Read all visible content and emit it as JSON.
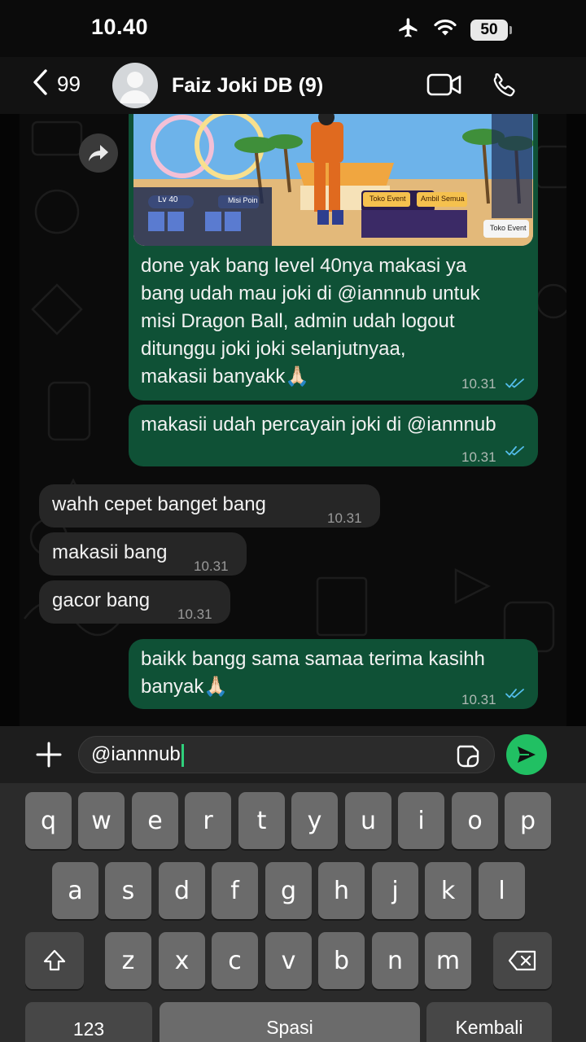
{
  "status_bar": {
    "time": "10.40",
    "battery": "50",
    "icons": [
      "airplane-icon",
      "wifi-icon",
      "battery-icon"
    ]
  },
  "header": {
    "back_count": "99",
    "title": "Faiz Joki DB (9)",
    "icons": [
      "back-chevron-icon",
      "avatar-icon",
      "video-call-icon",
      "phone-call-icon"
    ]
  },
  "messages": [
    {
      "direction": "out",
      "has_image": true,
      "text": "done yak bang level 40nya makasi ya\nbang udah mau joki di @iannnub untuk\nmisi Dragon Ball, admin udah logout\nditunggu joki joki selanjutnyaa,\nmakasii banyakk🙏🏻",
      "time": "10.31",
      "status": "read"
    },
    {
      "direction": "out",
      "text": "makasii udah percayain joki di @iannnub",
      "time": "10.31",
      "status": "read"
    },
    {
      "direction": "in",
      "text": "wahh cepet banget bang",
      "time": "10.31"
    },
    {
      "direction": "in",
      "text": "makasii bang",
      "time": "10.31"
    },
    {
      "direction": "in",
      "text": "gacor bang",
      "time": "10.31"
    },
    {
      "direction": "out",
      "text": "baikk bangg sama samaa terima kasihh\nbanyak🙏🏻",
      "time": "10.31",
      "status": "read"
    }
  ],
  "game_image": {
    "level_label": "Lv 40",
    "misi_label": "Misi Poin",
    "toko_event_label": "Toko Event",
    "ambil_semua_label": "Ambil Semua",
    "toko_event_button": "Toko Event"
  },
  "composer": {
    "value": "@iannnub"
  },
  "keyboard": {
    "row1": [
      "q",
      "w",
      "e",
      "r",
      "t",
      "y",
      "u",
      "i",
      "o",
      "p"
    ],
    "row2": [
      "a",
      "s",
      "d",
      "f",
      "g",
      "h",
      "j",
      "k",
      "l"
    ],
    "row3": [
      "z",
      "x",
      "c",
      "v",
      "b",
      "n",
      "m"
    ],
    "numbers_key": "123",
    "space_key": "Spasi",
    "return_key": "Kembali"
  },
  "colors": {
    "outgoing_bubble": "#0f5136",
    "incoming_bubble": "#262626",
    "send_button": "#21c063",
    "read_ticks": "#53bdeb"
  }
}
